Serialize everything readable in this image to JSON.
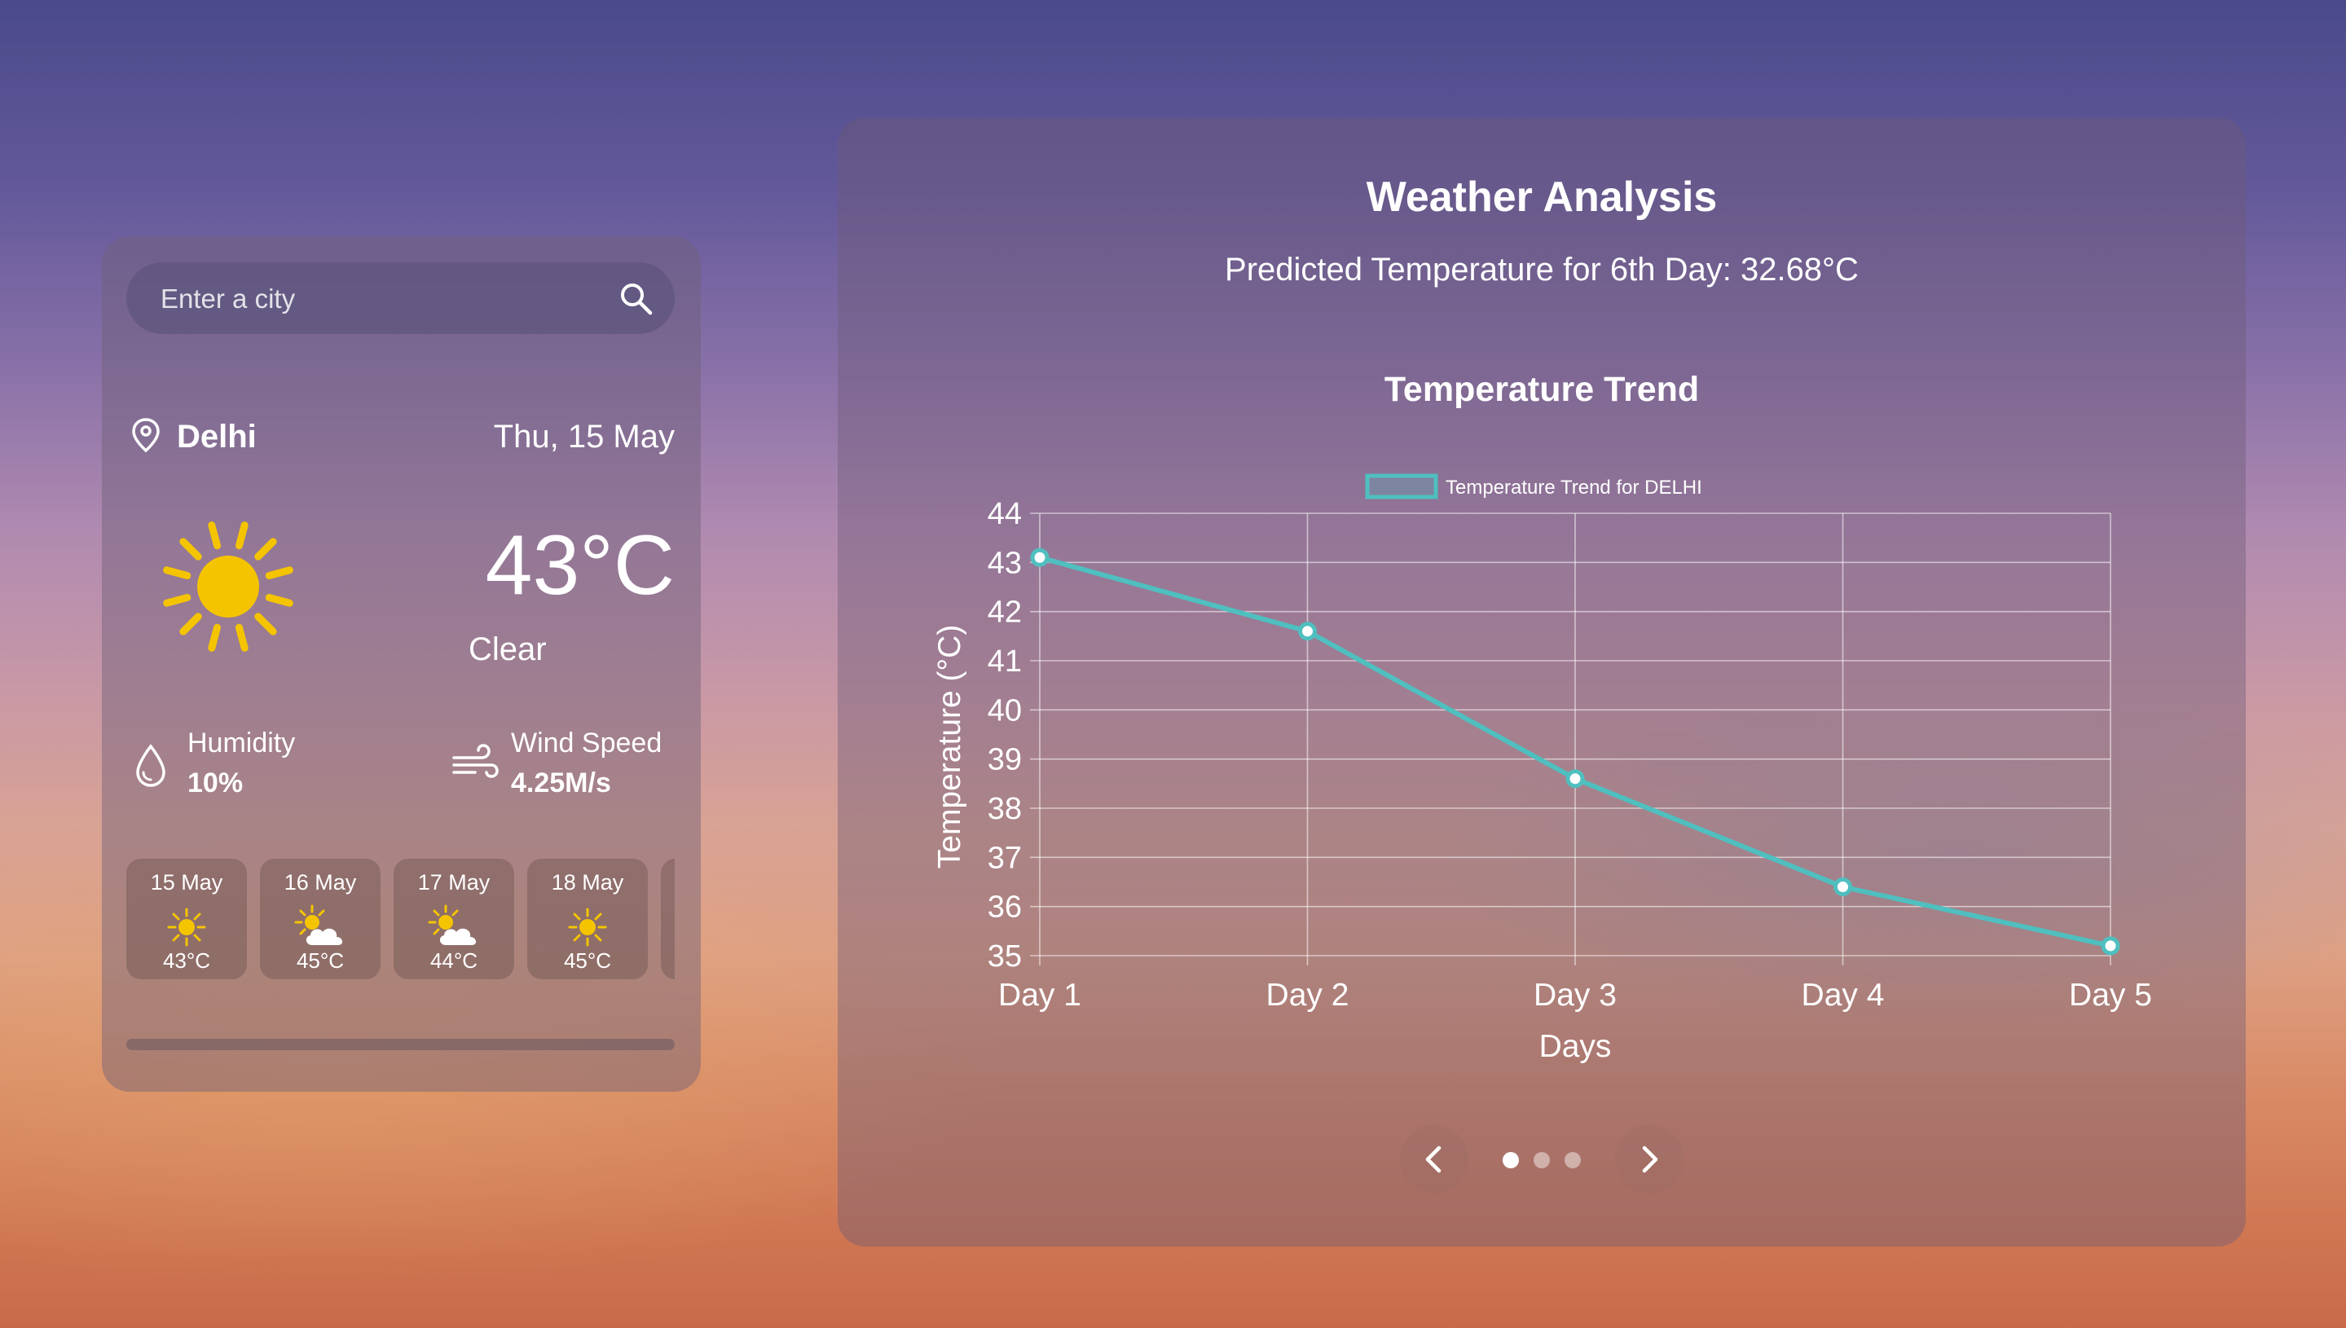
{
  "search": {
    "placeholder": "Enter a city",
    "icon": "search-icon"
  },
  "current": {
    "city": "Delhi",
    "date": "Thu, 15 May",
    "temperature": "43°C",
    "condition": "Clear",
    "condition_icon": "sun-icon",
    "humidity_label": "Humidity",
    "humidity_value": "10%",
    "wind_label": "Wind Speed",
    "wind_value": "4.25M/s"
  },
  "forecast": [
    {
      "date": "15 May",
      "temp": "43°C",
      "icon": "sun-icon"
    },
    {
      "date": "16 May",
      "temp": "45°C",
      "icon": "partly-cloudy-icon"
    },
    {
      "date": "17 May",
      "temp": "44°C",
      "icon": "partly-cloudy-icon"
    },
    {
      "date": "18 May",
      "temp": "45°C",
      "icon": "sun-icon"
    }
  ],
  "analysis": {
    "title": "Weather Analysis",
    "prediction": "Predicted Temperature for 6th Day: 32.68°C",
    "carousel": {
      "active_index": 0,
      "count": 3
    }
  },
  "chart_data": {
    "type": "line",
    "title": "Temperature Trend",
    "categories": [
      "Day 1",
      "Day 2",
      "Day 3",
      "Day 4",
      "Day 5"
    ],
    "series": [
      {
        "name": "Temperature Trend for DELHI",
        "values": [
          43.1,
          41.6,
          38.6,
          36.4,
          35.2
        ]
      }
    ],
    "xlabel": "Days",
    "ylabel": "Temperature (°C)",
    "ylim": [
      35,
      44
    ],
    "yticks": [
      35,
      36,
      37,
      38,
      39,
      40,
      41,
      42,
      43,
      44
    ],
    "grid": true,
    "legend": "top-center",
    "color": "#4fbfbf"
  },
  "colors": {
    "accent": "#4fbfbf",
    "sun": "#f5c400"
  }
}
